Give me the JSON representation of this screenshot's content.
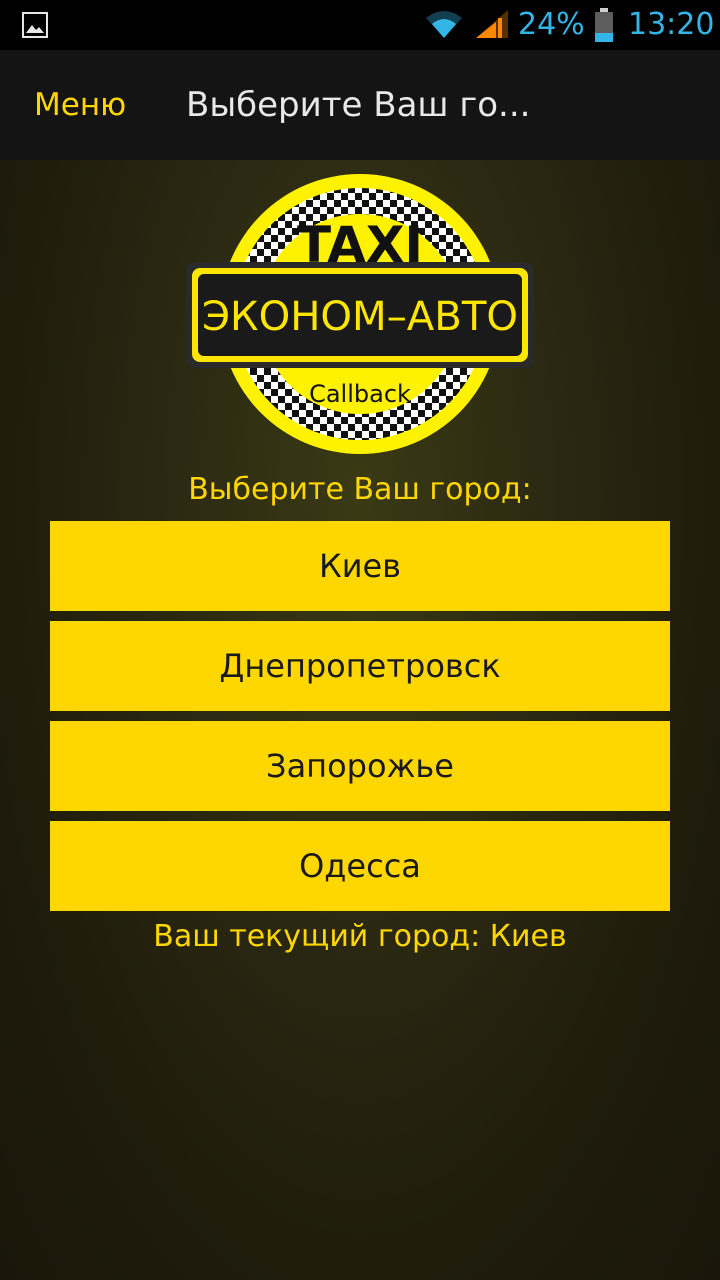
{
  "status_bar": {
    "left_icon": "image-notification-icon",
    "wifi_icon": "wifi-icon",
    "signal_icon": "signal-icon",
    "battery_percent": "24%",
    "battery_icon": "battery-icon",
    "time": "13:20",
    "accent_color": "#33b5e5"
  },
  "action_bar": {
    "menu_label": "Меню",
    "title": "Выберите Ваш го..."
  },
  "logo": {
    "top_text": "TAXI",
    "main_text": "ЭКОНОМ–АВТО",
    "bottom_text": "Callback"
  },
  "content": {
    "prompt": "Выберите Ваш город:",
    "cities": [
      {
        "label": "Киев"
      },
      {
        "label": "Днепропетровск"
      },
      {
        "label": "Запорожье"
      },
      {
        "label": "Одесса"
      }
    ],
    "current_city_text": "Ваш текущий город: Киев"
  },
  "colors": {
    "brand_yellow": "#ffd700",
    "action_bar_bg": "#141414",
    "button_text": "#1a1a1a"
  }
}
